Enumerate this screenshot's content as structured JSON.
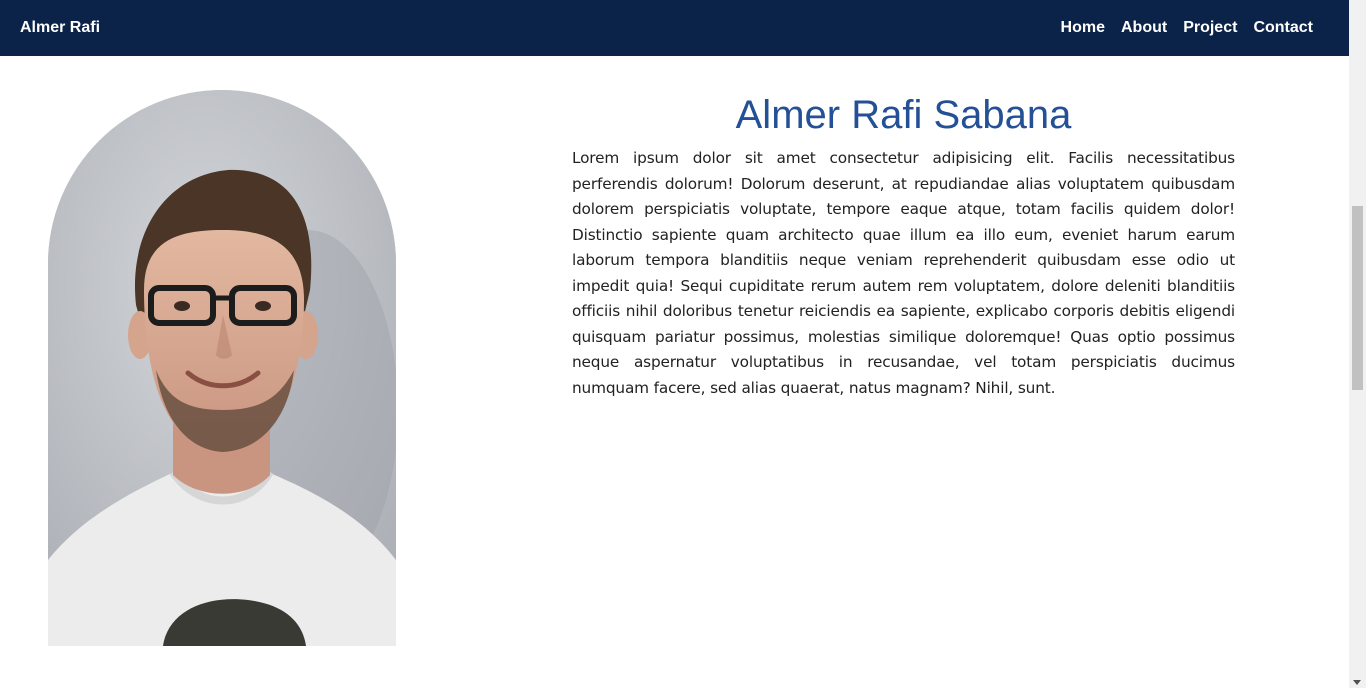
{
  "navbar": {
    "brand": "Almer Rafi",
    "links": [
      "Home",
      "About",
      "Project",
      "Contact"
    ],
    "background": "#0b2349"
  },
  "about": {
    "title": "Almer Rafi Sabana",
    "title_color": "#245096",
    "paragraph": "Lorem ipsum dolor sit amet consectetur adipisicing elit. Facilis necessitatibus perferendis dolorum! Dolorum deserunt, at repudiandae alias voluptatem quibusdam dolorem perspiciatis voluptate, tempore eaque atque, totam facilis quidem dolor! Distinctio sapiente quam architecto quae illum ea illo eum, eveniet harum earum laborum tempora blanditiis neque veniam reprehenderit quibusdam esse odio ut impedit quia! Sequi cupiditate rerum autem rem voluptatem, dolore deleniti blanditiis officiis nihil doloribus tenetur reiciendis ea sapiente, explicabo corporis debitis eligendi quisquam pariatur possimus, molestias similique doloremque! Quas optio possimus neque aspernatur voluptatibus in recusandae, vel totam perspiciatis ducimus numquam facere, sed alias quaerat, natus magnam? Nihil, sunt."
  }
}
